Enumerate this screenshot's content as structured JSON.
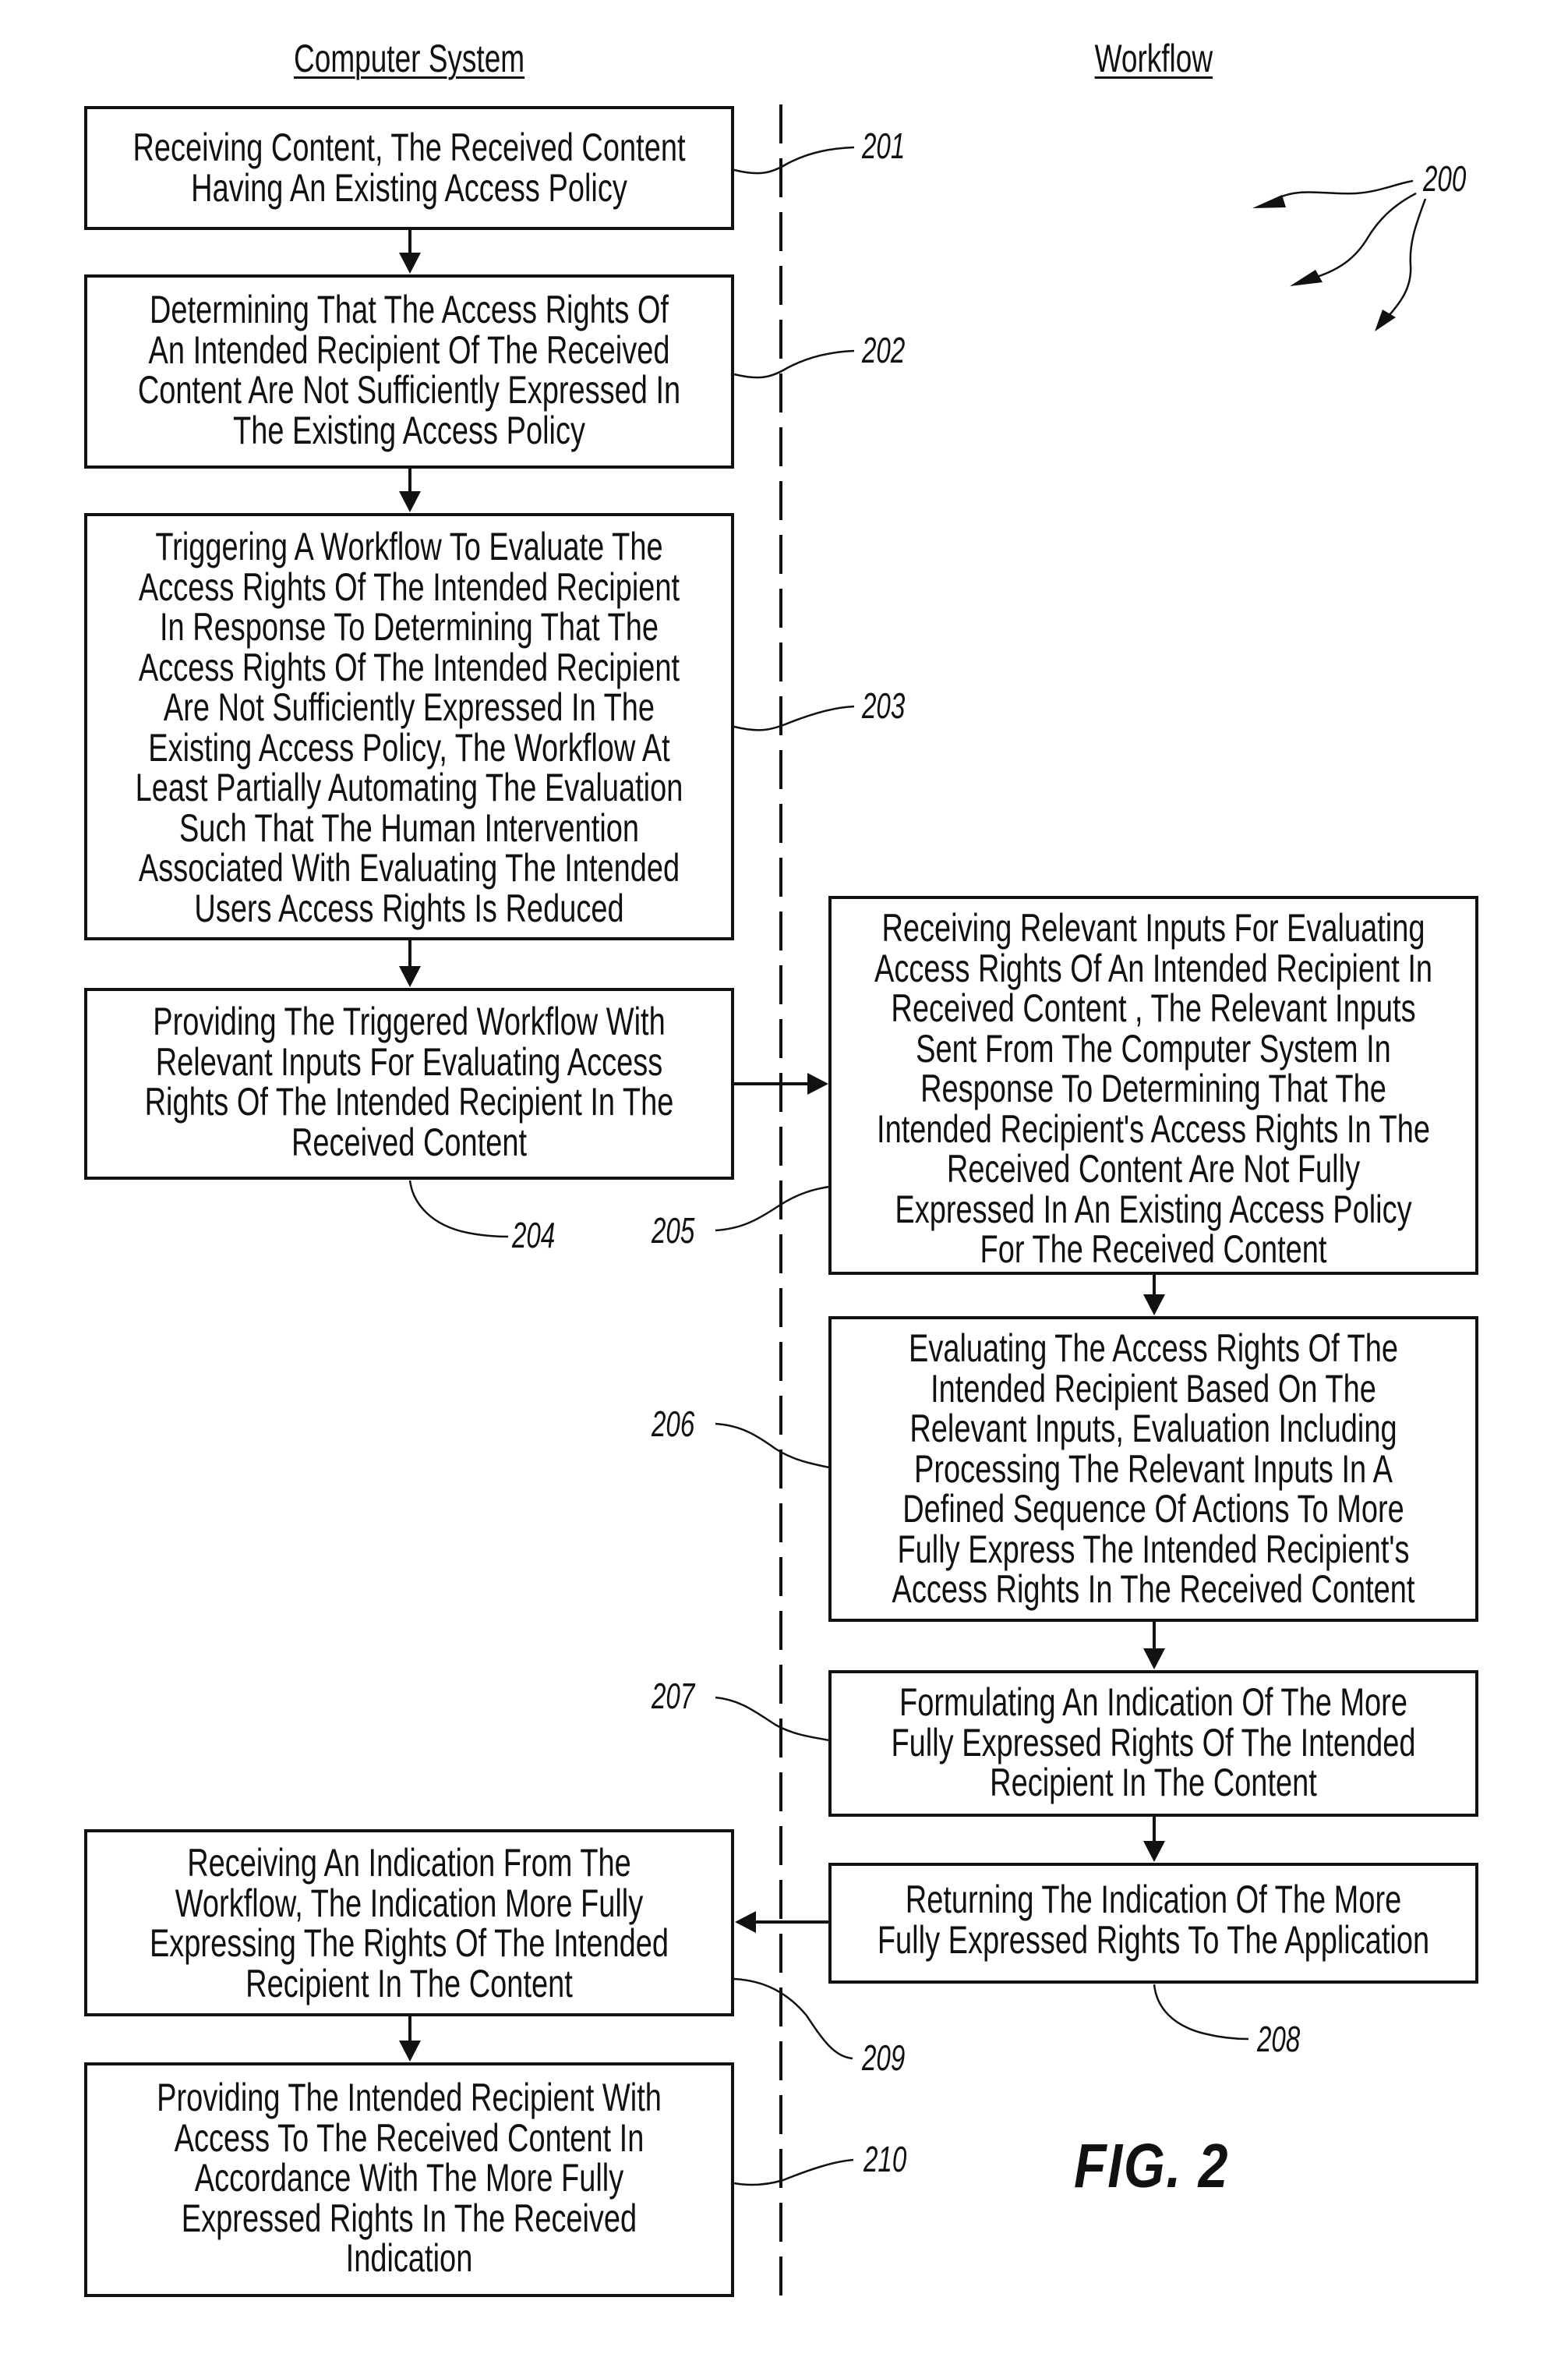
{
  "figure": {
    "label": "FIG.  2",
    "reference": "200",
    "columns": {
      "left": "Computer System",
      "right": "Workflow"
    },
    "steps": {
      "s201": {
        "ref": "201",
        "lines": [
          "Receiving Content, The Received Content",
          "Having An Existing Access Policy"
        ]
      },
      "s202": {
        "ref": "202",
        "lines": [
          "Determining That The Access Rights Of",
          "An Intended Recipient Of The Received",
          "Content Are Not Sufficiently Expressed In",
          "The Existing Access Policy"
        ]
      },
      "s203": {
        "ref": "203",
        "lines": [
          "Triggering A Workflow To Evaluate The",
          "Access Rights Of The Intended Recipient",
          "In Response To Determining That The",
          "Access Rights Of The Intended Recipient",
          "Are Not Sufficiently Expressed In The",
          "Existing Access Policy, The Workflow At",
          "Least Partially Automating The Evaluation",
          "Such That The Human Intervention",
          "Associated With Evaluating The Intended",
          "Users Access Rights Is Reduced"
        ]
      },
      "s204": {
        "ref": "204",
        "lines": [
          "Providing The Triggered Workflow With",
          "Relevant Inputs For Evaluating Access",
          "Rights Of The Intended Recipient In The",
          "Received Content"
        ]
      },
      "s205": {
        "ref": "205",
        "lines": [
          "Receiving Relevant Inputs For Evaluating",
          "Access Rights Of An Intended Recipient In",
          "Received Content , The Relevant Inputs",
          "Sent From The Computer System In",
          "Response To Determining That The",
          "Intended Recipient's Access Rights In The",
          "Received Content Are Not Fully",
          "Expressed In An Existing Access Policy",
          "For The Received Content"
        ]
      },
      "s206": {
        "ref": "206",
        "lines": [
          "Evaluating The Access Rights Of The",
          "Intended Recipient Based On The",
          "Relevant Inputs, Evaluation Including",
          "Processing The Relevant Inputs In A",
          "Defined Sequence Of Actions To More",
          "Fully Express The Intended Recipient's",
          "Access Rights In The Received Content"
        ]
      },
      "s207": {
        "ref": "207",
        "lines": [
          "Formulating An Indication Of The More",
          "Fully Expressed Rights Of The Intended",
          "Recipient In The Content"
        ]
      },
      "s208": {
        "ref": "208",
        "lines": [
          "Returning The Indication Of The More",
          "Fully Expressed Rights To The Application"
        ]
      },
      "s209": {
        "ref": "209",
        "lines": [
          "Receiving An Indication From The",
          "Workflow, The Indication More Fully",
          "Expressing The Rights Of The Intended",
          "Recipient In The Content"
        ]
      },
      "s210": {
        "ref": "210",
        "lines": [
          "Providing The Intended Recipient With",
          "Access To The Received Content In",
          "Accordance With The More Fully",
          "Expressed Rights In The Received",
          "Indication"
        ]
      }
    },
    "flow": [
      {
        "from": "201",
        "to": "202"
      },
      {
        "from": "202",
        "to": "203"
      },
      {
        "from": "203",
        "to": "204"
      },
      {
        "from": "204",
        "to": "205"
      },
      {
        "from": "205",
        "to": "206"
      },
      {
        "from": "206",
        "to": "207"
      },
      {
        "from": "207",
        "to": "208"
      },
      {
        "from": "208",
        "to": "209"
      },
      {
        "from": "209",
        "to": "210"
      }
    ]
  }
}
